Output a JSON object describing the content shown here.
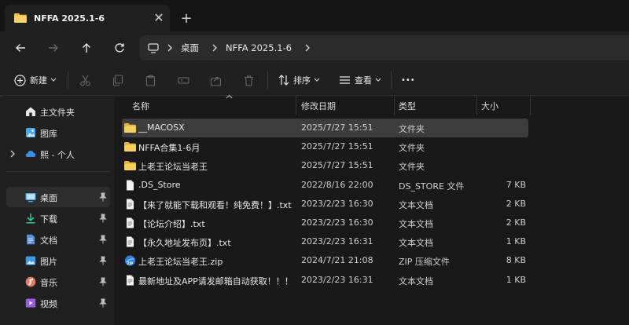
{
  "tab": {
    "title": "NFFA 2025.1-6",
    "close_label": "✕",
    "new_tab_label": "+"
  },
  "address": {
    "segments": [
      "桌面",
      "NFFA 2025.1-6"
    ]
  },
  "toolbar": {
    "new_label": "新建",
    "sort_label": "排序",
    "view_label": "查看",
    "more_label": "•••"
  },
  "sidebar": {
    "items": [
      {
        "label": "主文件夹",
        "icon": "home-icon"
      },
      {
        "label": "图库",
        "icon": "gallery-icon"
      },
      {
        "label": "熙 - 个人",
        "icon": "cloud-icon"
      },
      {
        "label": "桌面",
        "icon": "desktop-icon",
        "pinned": true
      },
      {
        "label": "下载",
        "icon": "download-icon",
        "pinned": true
      },
      {
        "label": "文档",
        "icon": "document-icon",
        "pinned": true
      },
      {
        "label": "图片",
        "icon": "picture-icon",
        "pinned": true
      },
      {
        "label": "音乐",
        "icon": "music-icon",
        "pinned": true
      },
      {
        "label": "视频",
        "icon": "video-icon",
        "pinned": true
      }
    ]
  },
  "columns": {
    "name": "名称",
    "date": "修改日期",
    "type": "类型",
    "size": "大小"
  },
  "files": [
    {
      "name": "__MACOSX",
      "date": "2025/7/27 15:51",
      "type": "文件夹",
      "size": "",
      "icon": "folder-icon"
    },
    {
      "name": "NFFA合集1-6月",
      "date": "2025/7/27 15:51",
      "type": "文件夹",
      "size": "",
      "icon": "folder-icon"
    },
    {
      "name": "上老王论坛当老王",
      "date": "2025/7/27 15:51",
      "type": "文件夹",
      "size": "",
      "icon": "folder-icon"
    },
    {
      "name": ".DS_Store",
      "date": "2022/8/16 22:00",
      "type": "DS_STORE 文件",
      "size": "7 KB",
      "icon": "file-icon"
    },
    {
      "name": "【来了就能下载和观看！纯免费！】.txt",
      "date": "2023/2/23 16:30",
      "type": "文本文档",
      "size": "2 KB",
      "icon": "text-file-icon"
    },
    {
      "name": "【论坛介绍】.txt",
      "date": "2023/2/23 16:30",
      "type": "文本文档",
      "size": "2 KB",
      "icon": "text-file-icon"
    },
    {
      "name": "【永久地址发布页】.txt",
      "date": "2023/2/23 16:31",
      "type": "文本文档",
      "size": "1 KB",
      "icon": "text-file-icon"
    },
    {
      "name": "上老王论坛当老王.zip",
      "date": "2024/7/21 21:08",
      "type": "ZIP 压缩文件",
      "size": "8 KB",
      "icon": "zip-icon"
    },
    {
      "name": "最新地址及APP请发邮箱自动获取！！！....",
      "date": "2023/2/23 16:31",
      "type": "文本文档",
      "size": "1 KB",
      "icon": "text-file-icon"
    }
  ],
  "colors": {
    "folder": "#f3c245",
    "accent": "#4cc2ff",
    "selected": "#3d3d3d"
  }
}
